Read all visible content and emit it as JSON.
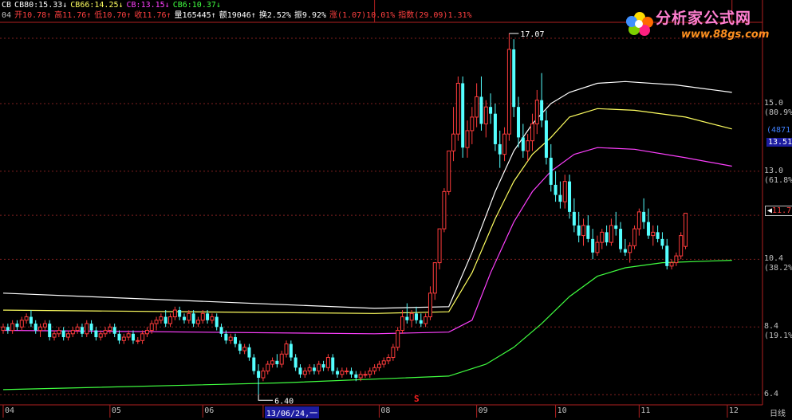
{
  "header": {
    "ma": [
      {
        "label": "CB",
        "color": "#ffffff"
      },
      {
        "label": "CB80:15.33↓",
        "color": "#ffffff"
      },
      {
        "label": "CB66:14.25↓",
        "color": "#ffff60"
      },
      {
        "label": "CB:13.15↓",
        "color": "#ff40ff"
      },
      {
        "label": "CB6:10.37↓",
        "color": "#40ff40"
      }
    ],
    "quote": [
      {
        "label": "04",
        "color": "#c0c0c0"
      },
      {
        "label": "开10.78↑",
        "color": "#ff4040"
      },
      {
        "label": "高11.76↑",
        "color": "#ff4040"
      },
      {
        "label": "低10.70↑",
        "color": "#ff4040"
      },
      {
        "label": "收11.76↑",
        "color": "#ff4040"
      },
      {
        "label": "量165445↑",
        "color": "#ffffff"
      },
      {
        "label": "额19046↑",
        "color": "#ffffff"
      },
      {
        "label": "换2.52%",
        "color": "#ffffff"
      },
      {
        "label": "振9.92%",
        "color": "#ffffff"
      },
      {
        "label": "涨(1.07)10.01%",
        "color": "#ff4040"
      },
      {
        "label": "指数(29.09)1.31%",
        "color": "#ff4040"
      }
    ]
  },
  "logo": {
    "text": "分析家公式网",
    "url": "www.88gs.com"
  },
  "right_axis": {
    "price_labels": [
      {
        "value": "15.0",
        "pct": "(80.9%)",
        "price": 15.0
      },
      {
        "value": "13.0",
        "pct": "(61.8%)",
        "price": 13.0
      },
      {
        "value": "10.4",
        "pct": "(38.2%)",
        "price": 10.4
      },
      {
        "value": "8.4",
        "pct": "(19.1%)",
        "price": 8.4
      },
      {
        "value": "6.4",
        "pct": "",
        "price": 6.4
      }
    ],
    "current_price": "11.7",
    "cursor_vol": "(4871",
    "cursor_price": "13.51",
    "period": "日线"
  },
  "annotations": {
    "high": "17.07",
    "low": "6.40",
    "marker": "S"
  },
  "x_axis": {
    "months": [
      {
        "label": "04",
        "i": 0
      },
      {
        "label": "05",
        "i": 23
      },
      {
        "label": "06",
        "i": 43
      },
      {
        "label": "13/06/24,一",
        "i": 56
      },
      {
        "label": "08",
        "i": 81
      },
      {
        "label": "09",
        "i": 102
      },
      {
        "label": "10",
        "i": 119
      },
      {
        "label": "11",
        "i": 137
      },
      {
        "label": "12",
        "i": 156
      }
    ]
  },
  "chart_data": {
    "type": "candlestick",
    "ylim": [
      6.1,
      17.4
    ],
    "grid": true,
    "candles": [
      [
        8.3,
        8.5,
        8.2,
        8.4
      ],
      [
        8.4,
        8.5,
        8.2,
        8.3
      ],
      [
        8.3,
        8.6,
        8.2,
        8.5
      ],
      [
        8.5,
        8.6,
        8.3,
        8.4
      ],
      [
        8.4,
        8.7,
        8.3,
        8.6
      ],
      [
        8.6,
        8.8,
        8.5,
        8.7
      ],
      [
        8.7,
        8.9,
        8.4,
        8.5
      ],
      [
        8.5,
        8.6,
        8.2,
        8.3
      ],
      [
        8.3,
        8.5,
        8.1,
        8.4
      ],
      [
        8.4,
        8.6,
        8.3,
        8.5
      ],
      [
        8.5,
        8.6,
        8.0,
        8.1
      ],
      [
        8.1,
        8.3,
        8.0,
        8.2
      ],
      [
        8.2,
        8.4,
        8.1,
        8.3
      ],
      [
        8.3,
        8.4,
        8.0,
        8.1
      ],
      [
        8.1,
        8.3,
        8.0,
        8.2
      ],
      [
        8.2,
        8.4,
        8.1,
        8.3
      ],
      [
        8.3,
        8.5,
        8.2,
        8.4
      ],
      [
        8.4,
        8.5,
        8.1,
        8.2
      ],
      [
        8.2,
        8.6,
        8.1,
        8.5
      ],
      [
        8.5,
        8.6,
        8.2,
        8.3
      ],
      [
        8.3,
        8.4,
        8.0,
        8.1
      ],
      [
        8.1,
        8.3,
        8.0,
        8.2
      ],
      [
        8.2,
        8.4,
        8.1,
        8.3
      ],
      [
        8.3,
        8.5,
        8.2,
        8.4
      ],
      [
        8.4,
        8.5,
        8.1,
        8.2
      ],
      [
        8.2,
        8.3,
        7.9,
        8.0
      ],
      [
        8.0,
        8.2,
        7.9,
        8.1
      ],
      [
        8.1,
        8.3,
        8.0,
        8.2
      ],
      [
        8.2,
        8.3,
        7.9,
        8.0
      ],
      [
        8.0,
        8.1,
        7.9,
        8.0
      ],
      [
        8.0,
        8.3,
        7.9,
        8.2
      ],
      [
        8.2,
        8.4,
        8.1,
        8.3
      ],
      [
        8.3,
        8.6,
        8.2,
        8.5
      ],
      [
        8.5,
        8.7,
        8.3,
        8.6
      ],
      [
        8.6,
        8.8,
        8.5,
        8.7
      ],
      [
        8.7,
        8.9,
        8.4,
        8.5
      ],
      [
        8.5,
        8.8,
        8.4,
        8.7
      ],
      [
        8.7,
        9.0,
        8.6,
        8.9
      ],
      [
        8.9,
        9.0,
        8.6,
        8.7
      ],
      [
        8.7,
        8.8,
        8.5,
        8.6
      ],
      [
        8.6,
        8.9,
        8.5,
        8.8
      ],
      [
        8.8,
        8.9,
        8.4,
        8.5
      ],
      [
        8.5,
        8.7,
        8.4,
        8.6
      ],
      [
        8.6,
        8.9,
        8.5,
        8.8
      ],
      [
        8.8,
        8.9,
        8.5,
        8.6
      ],
      [
        8.6,
        8.8,
        8.5,
        8.7
      ],
      [
        8.7,
        8.8,
        8.3,
        8.4
      ],
      [
        8.4,
        8.5,
        8.1,
        8.2
      ],
      [
        8.2,
        8.3,
        7.9,
        8.0
      ],
      [
        8.0,
        8.2,
        7.9,
        8.1
      ],
      [
        8.1,
        8.2,
        7.8,
        7.9
      ],
      [
        7.9,
        8.0,
        7.6,
        7.7
      ],
      [
        7.7,
        7.9,
        7.6,
        7.8
      ],
      [
        7.8,
        7.9,
        7.4,
        7.5
      ],
      [
        7.5,
        7.6,
        7.0,
        7.1
      ],
      [
        7.1,
        7.3,
        6.4,
        6.9
      ],
      [
        6.9,
        7.2,
        6.8,
        7.1
      ],
      [
        7.1,
        7.4,
        7.0,
        7.3
      ],
      [
        7.3,
        7.5,
        7.2,
        7.4
      ],
      [
        7.4,
        7.6,
        7.2,
        7.3
      ],
      [
        7.3,
        7.7,
        7.2,
        7.6
      ],
      [
        7.6,
        8.0,
        7.5,
        7.9
      ],
      [
        7.9,
        8.0,
        7.4,
        7.5
      ],
      [
        7.5,
        7.6,
        7.1,
        7.2
      ],
      [
        7.2,
        7.3,
        6.9,
        7.0
      ],
      [
        7.0,
        7.2,
        6.9,
        7.1
      ],
      [
        7.1,
        7.3,
        7.0,
        7.2
      ],
      [
        7.2,
        7.3,
        7.0,
        7.1
      ],
      [
        7.1,
        7.4,
        7.0,
        7.3
      ],
      [
        7.3,
        7.4,
        7.1,
        7.2
      ],
      [
        7.2,
        7.6,
        7.1,
        7.5
      ],
      [
        7.5,
        7.6,
        7.0,
        7.1
      ],
      [
        7.1,
        7.2,
        6.9,
        7.0
      ],
      [
        7.0,
        7.2,
        6.9,
        7.1
      ],
      [
        7.1,
        7.2,
        7.0,
        7.1
      ],
      [
        7.1,
        7.2,
        6.9,
        7.0
      ],
      [
        7.0,
        7.1,
        6.8,
        6.9
      ],
      [
        6.9,
        7.1,
        6.8,
        7.0
      ],
      [
        7.0,
        7.1,
        6.9,
        7.0
      ],
      [
        7.0,
        7.2,
        6.9,
        7.1
      ],
      [
        7.1,
        7.3,
        7.0,
        7.2
      ],
      [
        7.2,
        7.4,
        7.1,
        7.3
      ],
      [
        7.3,
        7.5,
        7.2,
        7.4
      ],
      [
        7.4,
        7.6,
        7.3,
        7.5
      ],
      [
        7.5,
        7.9,
        7.4,
        7.8
      ],
      [
        7.8,
        8.4,
        7.7,
        8.3
      ],
      [
        8.3,
        8.9,
        8.2,
        8.7
      ],
      [
        8.7,
        9.1,
        8.5,
        8.6
      ],
      [
        8.6,
        8.9,
        8.4,
        8.8
      ],
      [
        8.8,
        9.0,
        8.5,
        8.6
      ],
      [
        8.6,
        8.8,
        8.4,
        8.5
      ],
      [
        8.5,
        8.8,
        8.4,
        8.7
      ],
      [
        8.7,
        9.6,
        8.6,
        9.4
      ],
      [
        9.4,
        10.3,
        9.2,
        10.3
      ],
      [
        10.3,
        11.3,
        10.1,
        11.3
      ],
      [
        11.3,
        12.5,
        11.2,
        12.4
      ],
      [
        12.4,
        13.6,
        12.3,
        13.6
      ],
      [
        13.6,
        14.9,
        13.3,
        14.1
      ],
      [
        14.1,
        15.8,
        13.9,
        15.6
      ],
      [
        15.6,
        15.8,
        13.4,
        13.7
      ],
      [
        13.7,
        14.5,
        13.4,
        14.2
      ],
      [
        14.2,
        14.9,
        13.8,
        14.6
      ],
      [
        14.6,
        15.6,
        14.3,
        15.2
      ],
      [
        15.2,
        15.8,
        14.2,
        14.4
      ],
      [
        14.4,
        15.1,
        14.0,
        14.9
      ],
      [
        14.9,
        15.3,
        14.4,
        14.7
      ],
      [
        14.7,
        15.0,
        13.6,
        13.8
      ],
      [
        13.8,
        14.2,
        13.1,
        13.5
      ],
      [
        13.5,
        14.3,
        13.3,
        14.1
      ],
      [
        14.1,
        17.07,
        13.9,
        16.6
      ],
      [
        16.6,
        16.9,
        14.6,
        14.9
      ],
      [
        14.9,
        15.2,
        13.7,
        14.0
      ],
      [
        14.0,
        14.4,
        13.4,
        13.6
      ],
      [
        13.6,
        14.1,
        13.3,
        13.9
      ],
      [
        13.9,
        14.7,
        13.6,
        14.4
      ],
      [
        14.4,
        15.4,
        14.1,
        15.1
      ],
      [
        15.1,
        15.9,
        14.3,
        14.5
      ],
      [
        14.5,
        14.8,
        13.2,
        13.4
      ],
      [
        13.4,
        13.8,
        12.4,
        12.6
      ],
      [
        12.6,
        13.0,
        12.1,
        12.3
      ],
      [
        12.3,
        12.7,
        11.9,
        12.1
      ],
      [
        12.1,
        12.9,
        11.9,
        12.7
      ],
      [
        12.7,
        12.9,
        11.6,
        11.8
      ],
      [
        11.8,
        12.2,
        11.2,
        11.4
      ],
      [
        11.4,
        11.8,
        10.9,
        11.1
      ],
      [
        11.1,
        11.6,
        10.8,
        11.4
      ],
      [
        11.4,
        11.7,
        10.9,
        11.0
      ],
      [
        11.0,
        11.3,
        10.4,
        10.6
      ],
      [
        10.6,
        11.1,
        10.5,
        10.9
      ],
      [
        10.9,
        11.3,
        10.7,
        11.2
      ],
      [
        11.2,
        11.4,
        10.8,
        10.9
      ],
      [
        10.9,
        11.6,
        10.8,
        11.4
      ],
      [
        11.4,
        11.8,
        11.1,
        11.3
      ],
      [
        11.3,
        11.5,
        10.6,
        10.7
      ],
      [
        10.7,
        11.0,
        10.5,
        10.6
      ],
      [
        10.6,
        10.9,
        10.3,
        10.8
      ],
      [
        10.8,
        11.4,
        10.7,
        11.3
      ],
      [
        11.3,
        11.9,
        11.1,
        11.8
      ],
      [
        11.8,
        12.2,
        11.3,
        11.5
      ],
      [
        11.5,
        11.9,
        11.0,
        11.1
      ],
      [
        11.1,
        11.4,
        10.8,
        11.2
      ],
      [
        11.2,
        11.4,
        10.9,
        11.0
      ],
      [
        11.0,
        11.2,
        10.7,
        10.8
      ],
      [
        10.8,
        11.0,
        10.1,
        10.2
      ],
      [
        10.2,
        10.4,
        10.1,
        10.3
      ],
      [
        10.3,
        10.6,
        10.2,
        10.5
      ],
      [
        10.5,
        11.2,
        10.4,
        11.1
      ],
      [
        10.78,
        11.76,
        10.7,
        11.76
      ]
    ],
    "ma_series": [
      {
        "name": "CB80",
        "color": "#ffffff",
        "points": [
          [
            0,
            9.4
          ],
          [
            80,
            8.95
          ],
          [
            96,
            9.0
          ],
          [
            101,
            10.6
          ],
          [
            106,
            12.4
          ],
          [
            110,
            13.6
          ],
          [
            114,
            14.4
          ],
          [
            118,
            15.0
          ],
          [
            122,
            15.33
          ],
          [
            128,
            15.6
          ],
          [
            134,
            15.65
          ],
          [
            145,
            15.55
          ],
          [
            157,
            15.33
          ]
        ]
      },
      {
        "name": "CB66",
        "color": "#ffff60",
        "points": [
          [
            0,
            8.9
          ],
          [
            80,
            8.8
          ],
          [
            96,
            8.85
          ],
          [
            101,
            10.0
          ],
          [
            106,
            11.6
          ],
          [
            110,
            12.7
          ],
          [
            114,
            13.5
          ],
          [
            118,
            14.0
          ],
          [
            122,
            14.6
          ],
          [
            128,
            14.85
          ],
          [
            136,
            14.8
          ],
          [
            147,
            14.6
          ],
          [
            157,
            14.25
          ]
        ]
      },
      {
        "name": "CB",
        "color": "#ff40ff",
        "points": [
          [
            0,
            8.3
          ],
          [
            80,
            8.2
          ],
          [
            96,
            8.25
          ],
          [
            101,
            8.6
          ],
          [
            105,
            10.0
          ],
          [
            110,
            11.5
          ],
          [
            114,
            12.4
          ],
          [
            118,
            13.0
          ],
          [
            123,
            13.5
          ],
          [
            128,
            13.7
          ],
          [
            136,
            13.65
          ],
          [
            147,
            13.4
          ],
          [
            157,
            13.15
          ]
        ]
      },
      {
        "name": "CB6",
        "color": "#40ff40",
        "points": [
          [
            0,
            6.55
          ],
          [
            60,
            6.75
          ],
          [
            96,
            6.95
          ],
          [
            104,
            7.3
          ],
          [
            110,
            7.8
          ],
          [
            116,
            8.5
          ],
          [
            122,
            9.3
          ],
          [
            128,
            9.9
          ],
          [
            134,
            10.15
          ],
          [
            142,
            10.3
          ],
          [
            157,
            10.37
          ]
        ]
      }
    ]
  }
}
